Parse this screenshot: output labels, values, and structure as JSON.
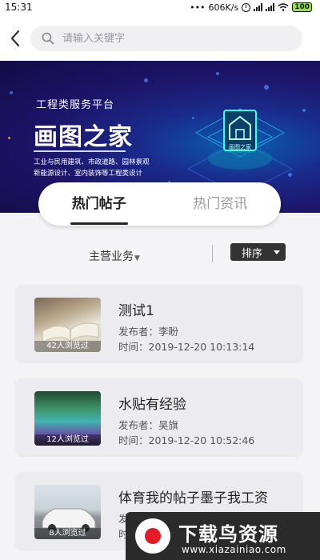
{
  "status_bar": {
    "time": "15:31",
    "network_speed": "606K/s",
    "battery": "100"
  },
  "header": {
    "back_icon": "chevron-left-icon",
    "search_icon": "search-icon",
    "search_placeholder": "请输入关键字"
  },
  "banner": {
    "subtitle": "工程类服务平台",
    "title": "画图之家",
    "line1": "工业与民用建筑、市政道路、园林景观",
    "line2": "新能源设计、室内装饰等工程类设计"
  },
  "tabs": [
    {
      "label": "热门帖子",
      "active": true
    },
    {
      "label": "热门资讯",
      "active": false
    }
  ],
  "filters": {
    "business_label": "主营业务",
    "sort_label": "排序"
  },
  "posts": [
    {
      "title": "测试1",
      "author": "发布者：李盼",
      "time": "时间：2019-12-20 10:13:14",
      "views": "42人浏览过"
    },
    {
      "title": "水贴有经验",
      "author": "发布者：吴旗",
      "time": "时间：2019-12-20 10:52:46",
      "views": "12人浏览过"
    },
    {
      "title": "体育我的帖子墨子我工资",
      "author": "发",
      "time": "时",
      "views": "8人浏览过"
    }
  ],
  "watermark": {
    "title": "下载鸟资源",
    "url": "www.xiazainiao.com"
  },
  "colors": {
    "banner_dark": "#120c45",
    "banner_blue": "#0a5fb0",
    "sort_button": "#333333",
    "card_bg": "#ececf0"
  }
}
